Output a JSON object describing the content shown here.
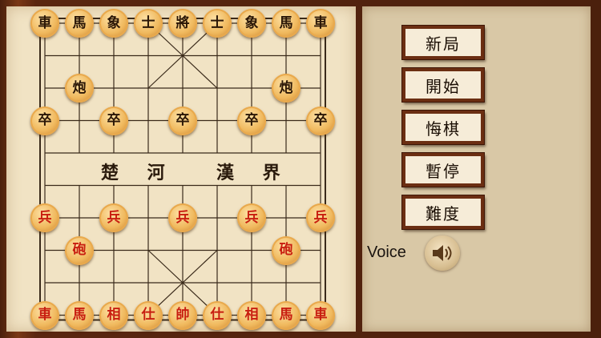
{
  "board": {
    "river_left": "楚 河",
    "river_right": "漢 界",
    "black_pieces": [
      {
        "label": "車",
        "file": 0,
        "rank": 0
      },
      {
        "label": "馬",
        "file": 1,
        "rank": 0
      },
      {
        "label": "象",
        "file": 2,
        "rank": 0
      },
      {
        "label": "士",
        "file": 3,
        "rank": 0
      },
      {
        "label": "將",
        "file": 4,
        "rank": 0
      },
      {
        "label": "士",
        "file": 5,
        "rank": 0
      },
      {
        "label": "象",
        "file": 6,
        "rank": 0
      },
      {
        "label": "馬",
        "file": 7,
        "rank": 0
      },
      {
        "label": "車",
        "file": 8,
        "rank": 0
      },
      {
        "label": "炮",
        "file": 1,
        "rank": 2
      },
      {
        "label": "炮",
        "file": 7,
        "rank": 2
      },
      {
        "label": "卒",
        "file": 0,
        "rank": 3
      },
      {
        "label": "卒",
        "file": 2,
        "rank": 3
      },
      {
        "label": "卒",
        "file": 4,
        "rank": 3
      },
      {
        "label": "卒",
        "file": 6,
        "rank": 3
      },
      {
        "label": "卒",
        "file": 8,
        "rank": 3
      }
    ],
    "red_pieces": [
      {
        "label": "兵",
        "file": 0,
        "rank": 6
      },
      {
        "label": "兵",
        "file": 2,
        "rank": 6
      },
      {
        "label": "兵",
        "file": 4,
        "rank": 6
      },
      {
        "label": "兵",
        "file": 6,
        "rank": 6
      },
      {
        "label": "兵",
        "file": 8,
        "rank": 6
      },
      {
        "label": "砲",
        "file": 1,
        "rank": 7
      },
      {
        "label": "砲",
        "file": 7,
        "rank": 7
      },
      {
        "label": "車",
        "file": 0,
        "rank": 9
      },
      {
        "label": "馬",
        "file": 1,
        "rank": 9
      },
      {
        "label": "相",
        "file": 2,
        "rank": 9
      },
      {
        "label": "仕",
        "file": 3,
        "rank": 9
      },
      {
        "label": "帥",
        "file": 4,
        "rank": 9
      },
      {
        "label": "仕",
        "file": 5,
        "rank": 9
      },
      {
        "label": "相",
        "file": 6,
        "rank": 9
      },
      {
        "label": "馬",
        "file": 7,
        "rank": 9
      },
      {
        "label": "車",
        "file": 8,
        "rank": 9
      }
    ]
  },
  "menu": {
    "new_game": "新局",
    "start": "開始",
    "undo": "悔棋",
    "pause": "暫停",
    "difficulty": "難度"
  },
  "voice": {
    "label": "Voice",
    "icon": "speaker-icon"
  },
  "colors": {
    "black_piece_text": "#2a1606",
    "red_piece_text": "#c81e10",
    "board_bg": "#f1e3c4",
    "frame": "#5a2a12"
  }
}
